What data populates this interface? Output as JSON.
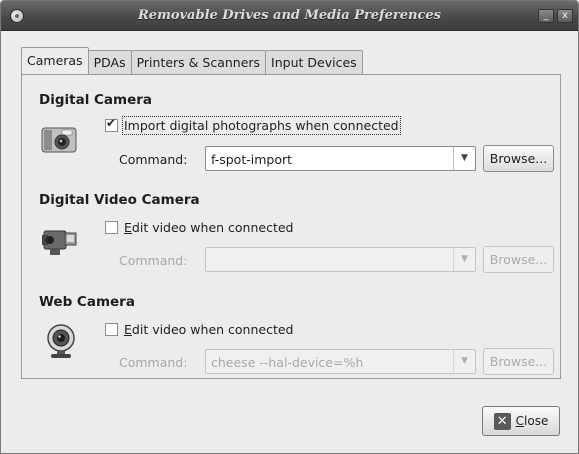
{
  "window": {
    "title": "Removable Drives and Media Preferences",
    "minimize_glyph": "_",
    "close_glyph": "x"
  },
  "tabs": [
    {
      "label": "Cameras",
      "active": true
    },
    {
      "label": "PDAs",
      "active": false
    },
    {
      "label": "Printers & Scanners",
      "active": false
    },
    {
      "label": "Input Devices",
      "active": false
    }
  ],
  "sections": {
    "digital_camera": {
      "title": "Digital Camera",
      "icon": "camera-icon",
      "checkbox_label": "Import digital photographs when connected",
      "checked": true,
      "command_label": "Command:",
      "command_value": "f-spot-import",
      "browse_label": "Browse..."
    },
    "digital_video_camera": {
      "title": "Digital Video Camera",
      "icon": "camcorder-icon",
      "checkbox_label": "Edit video when connected",
      "checked": false,
      "command_label": "Command:",
      "command_value": "",
      "browse_label": "Browse..."
    },
    "web_camera": {
      "title": "Web Camera",
      "icon": "webcam-icon",
      "checkbox_label": "Edit video when connected",
      "checked": false,
      "command_label": "Command:",
      "command_value": "cheese --hal-device=%h",
      "browse_label": "Browse..."
    }
  },
  "footer": {
    "close_label": "Close",
    "close_icon": "close-x-icon"
  },
  "colors": {
    "titlebar": "#4a4a4a",
    "window_bg": "#ececec",
    "disabled_text": "#a8a8a8"
  }
}
